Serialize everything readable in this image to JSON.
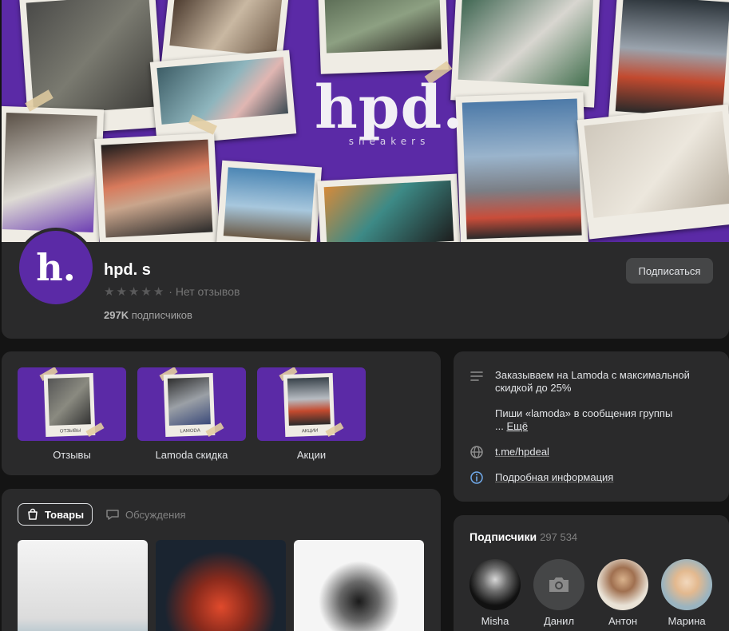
{
  "cover": {
    "brand_logo": "hpd.",
    "brand_sub": "sneakers"
  },
  "profile": {
    "avatar_letter": "h.",
    "name": "hpd. s",
    "reviews": "· Нет отзывов",
    "subscribers_count": "297K",
    "subscribers_label": "подписчиков",
    "subscribe_button": "Подписаться"
  },
  "albums": [
    {
      "label": "Отзывы",
      "caption": "ОТЗЫВЫ"
    },
    {
      "label": "Lamoda скидка",
      "caption": "LAMODA"
    },
    {
      "label": "Акции",
      "caption": "АКЦИИ"
    }
  ],
  "products": {
    "tab_goods": "Товары",
    "tab_discussions": "Обсуждения"
  },
  "info": {
    "desc_line1": "Заказываем на Lamoda с максимальной скидкой до 25%",
    "desc_line2": "Пиши «lamoda» в сообщения группы",
    "desc_ellipsis": "...",
    "more": "Ещё",
    "link": "t.me/hpdeal",
    "details": "Подробная информация"
  },
  "followers": {
    "title": "Подписчики",
    "count": "297 534",
    "items": [
      {
        "name": "Misha"
      },
      {
        "name": "Данил"
      },
      {
        "name": "Антон"
      },
      {
        "name": "Марина"
      }
    ]
  },
  "colors": {
    "brand_purple": "#5b2aa6",
    "card_bg": "#2a2a2b",
    "page_bg": "#141414"
  }
}
